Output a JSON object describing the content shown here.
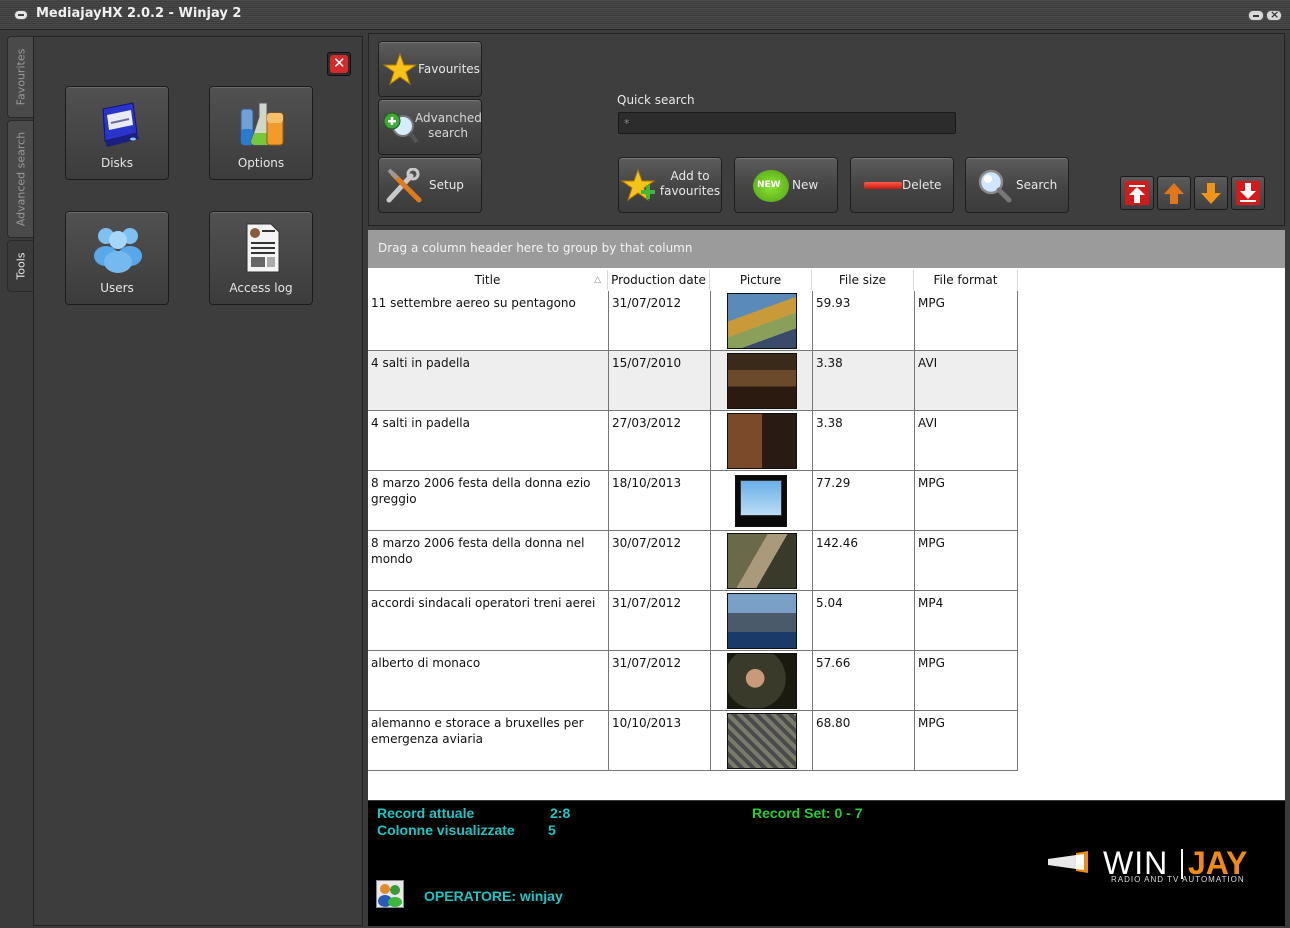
{
  "window": {
    "title": "MediajayHX 2.0.2 - Winjay 2"
  },
  "side_tabs": [
    {
      "label": "Favourites"
    },
    {
      "label": "Advanced search"
    },
    {
      "label": "Tools"
    }
  ],
  "tools": [
    {
      "label": "Disks",
      "icon": "disk-drive-icon"
    },
    {
      "label": "Options",
      "icon": "flasks-icon"
    },
    {
      "label": "Users",
      "icon": "users-icon"
    },
    {
      "label": "Access log",
      "icon": "document-log-icon"
    }
  ],
  "toolbar": {
    "favourites": "Favourites",
    "advanced_line1": "Advanched",
    "advanced_line2": "search",
    "setup": "Setup",
    "quick_search_label": "Quick search",
    "quick_search_value": "*",
    "add_fav_line1": "Add to",
    "add_fav_line2": "favourites",
    "new_label": "New",
    "new_badge": "NEW",
    "delete_label": "Delete",
    "search_label": "Search"
  },
  "grid": {
    "group_hint": "Drag a column header here to group by that column",
    "sort_arrow": "△",
    "columns": [
      "Title",
      "Production date",
      "Picture",
      "File size",
      "File format"
    ],
    "rows": [
      {
        "title": "11 settembre aereo su pentagono",
        "date": "31/07/2012",
        "size": "59.93",
        "format": "MPG"
      },
      {
        "title": "4 salti in padella",
        "date": "15/07/2010",
        "size": "3.38",
        "format": "AVI"
      },
      {
        "title": "4 salti in padella",
        "date": "27/03/2012",
        "size": "3.38",
        "format": "AVI"
      },
      {
        "title": "8 marzo 2006 festa della donna ezio greggio",
        "date": "18/10/2013",
        "size": "77.29",
        "format": "MPG"
      },
      {
        "title": "8 marzo 2006 festa della donna nel mondo",
        "date": "30/07/2012",
        "size": "142.46",
        "format": "MPG"
      },
      {
        "title": "accordi sindacali operatori treni aerei",
        "date": "31/07/2012",
        "size": "5.04",
        "format": "MP4"
      },
      {
        "title": "alberto di monaco",
        "date": "31/07/2012",
        "size": "57.66",
        "format": "MPG"
      },
      {
        "title": "alemanno e storace a bruxelles per emergenza aviaria",
        "date": "10/10/2013",
        "size": "68.80",
        "format": "MPG"
      }
    ]
  },
  "status": {
    "record_label": "Record attuale",
    "record_value": "2:8",
    "columns_label": "Colonne visualizzate",
    "columns_value": "5",
    "record_set": "Record Set: 0 - 7",
    "operator": "OPERATORE:  winjay"
  },
  "logo": {
    "win": "WIN",
    "jay": "JAY",
    "tagline": "RADIO AND TV AUTOMATION"
  },
  "colors": {
    "status_cyan": "#19c6c6",
    "status_green": "#22d22a",
    "logo_orange": "#f08a10",
    "delete_red": "#e0261e",
    "new_green": "#6cc61e"
  }
}
